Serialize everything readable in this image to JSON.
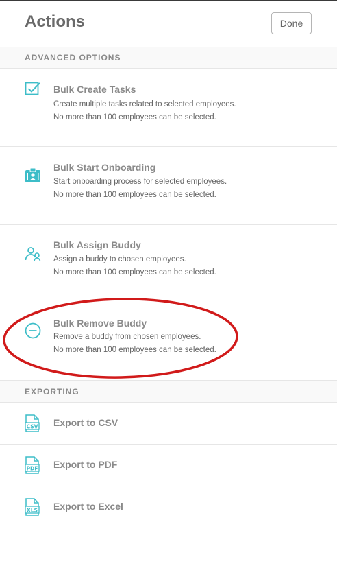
{
  "header": {
    "title": "Actions",
    "done_label": "Done"
  },
  "advanced": {
    "heading": "ADVANCED OPTIONS",
    "items": [
      {
        "name": "Bulk Create Tasks",
        "line1": "Create multiple tasks related to selected employees.",
        "line2": "No more than 100 employees can be selected.",
        "icon": "checkbox-task-icon"
      },
      {
        "name": "Bulk Start Onboarding",
        "line1": "Start onboarding process for selected employees.",
        "line2": "No more than 100 employees can be selected.",
        "icon": "badge-icon"
      },
      {
        "name": "Bulk Assign Buddy",
        "line1": "Assign a buddy to chosen employees.",
        "line2": "No more than 100 employees can be selected.",
        "icon": "people-icon"
      },
      {
        "name": "Bulk Remove Buddy",
        "line1": "Remove a buddy from chosen employees.",
        "line2": "No more than 100 employees can be selected.",
        "icon": "minus-circle-icon"
      }
    ]
  },
  "exporting": {
    "heading": "EXPORTING",
    "items": [
      {
        "label": "Export to CSV",
        "badge": "CSV"
      },
      {
        "label": "Export to PDF",
        "badge": "PDF"
      },
      {
        "label": "Export to Excel",
        "badge": "XLS"
      }
    ]
  },
  "colors": {
    "accent": "#3dbdc8",
    "annotation": "#d11a1a"
  }
}
